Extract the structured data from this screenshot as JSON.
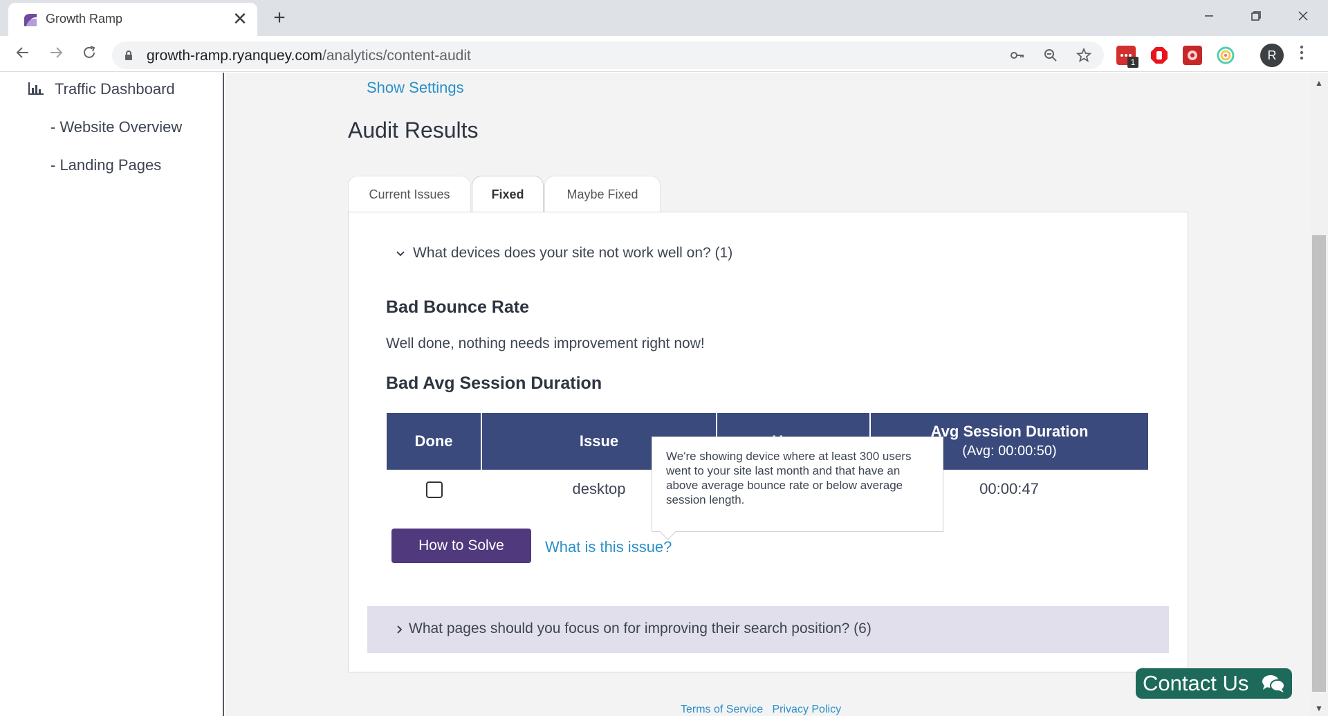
{
  "browser": {
    "tab_title": "Growth Ramp",
    "tab_close": "✕",
    "new_tab": "+",
    "url_host": "growth-ramp.ryanquey.com",
    "url_path": "/analytics/content-audit",
    "avatar_letter": "R",
    "extension_badge": "1",
    "window_controls": [
      "minimize-icon",
      "restore-icon",
      "close-icon"
    ]
  },
  "sidebar": {
    "items": [
      {
        "label": "Traffic Dashboard",
        "icon": "bar-chart-icon"
      },
      {
        "label": "- Website Overview"
      },
      {
        "label": "- Landing Pages"
      }
    ]
  },
  "main": {
    "show_settings": "Show Settings",
    "title": "Audit Results",
    "tabs": [
      {
        "label": "Current Issues",
        "active": false
      },
      {
        "label": "Fixed",
        "active": true
      },
      {
        "label": "Maybe Fixed",
        "active": false
      }
    ],
    "question": "What devices does your site not work well on? (1)",
    "sections": [
      {
        "title": "Bad Bounce Rate",
        "text": "Well done, nothing needs improvement right now!"
      },
      {
        "title": "Bad Avg Session Duration"
      }
    ],
    "table": {
      "headers": [
        "Done",
        "Issue",
        "Users",
        "Avg Session Duration"
      ],
      "header_sub": "(Avg: 00:00:50)",
      "rows": [
        {
          "done": false,
          "issue": "desktop",
          "users": "",
          "avg_session_duration": "00:00:47"
        }
      ]
    },
    "tooltip": "We're showing device where at least 300 users went to your site last month and that have an above average bounce rate or below average session length.",
    "how_to_solve": "How to Solve",
    "what_is_issue": "What is this issue?",
    "collapsed_question": "What pages should you focus on for improving their search position? (6)",
    "footer": {
      "terms": "Terms of Service",
      "privacy": "Privacy Policy"
    },
    "contact": "Contact Us"
  },
  "colors": {
    "table_header": "#3a4a7d",
    "solve_button": "#50397d",
    "link": "#2a8fc7",
    "contact_button": "#1d6a5b",
    "collapsed_bg": "#e1dfeb",
    "main_bg": "#f3f3f3"
  }
}
